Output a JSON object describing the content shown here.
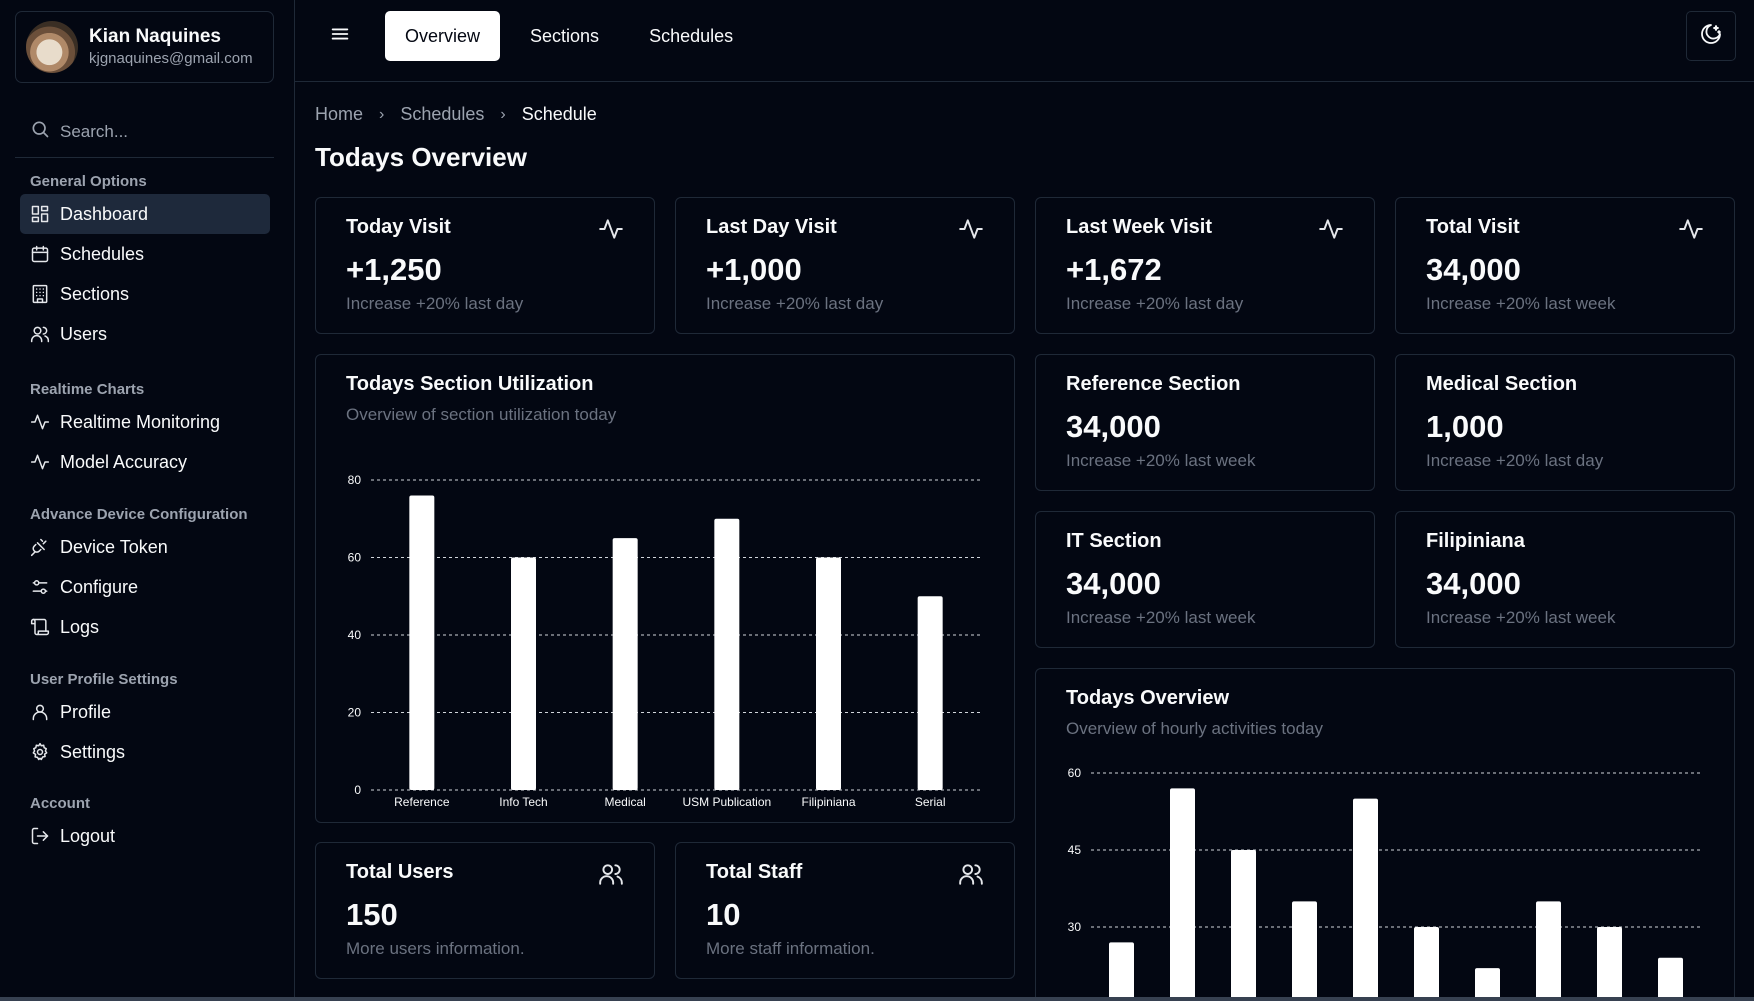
{
  "user": {
    "name": "Kian Naquines",
    "email": "kjgnaquines@gmail.com"
  },
  "search": {
    "placeholder": "Search..."
  },
  "sidebar": {
    "groups": [
      {
        "title": "General Options",
        "items": [
          {
            "label": "Dashboard",
            "icon": "dashboard-icon"
          },
          {
            "label": "Schedules",
            "icon": "calendar-icon"
          },
          {
            "label": "Sections",
            "icon": "building-icon"
          },
          {
            "label": "Users",
            "icon": "users-icon"
          }
        ]
      },
      {
        "title": "Realtime Charts",
        "items": [
          {
            "label": "Realtime Monitoring",
            "icon": "activity-icon"
          },
          {
            "label": "Model Accuracy",
            "icon": "activity-icon"
          }
        ]
      },
      {
        "title": "Advance Device Configuration",
        "items": [
          {
            "label": "Device Token",
            "icon": "plug-icon"
          },
          {
            "label": "Configure",
            "icon": "sliders-icon"
          },
          {
            "label": "Logs",
            "icon": "scroll-icon"
          }
        ]
      },
      {
        "title": "User Profile Settings",
        "items": [
          {
            "label": "Profile",
            "icon": "user-icon"
          },
          {
            "label": "Settings",
            "icon": "gear-icon"
          }
        ]
      },
      {
        "title": "Account",
        "items": [
          {
            "label": "Logout",
            "icon": "logout-icon"
          }
        ]
      }
    ]
  },
  "topbar": {
    "tabs": [
      "Overview",
      "Sections",
      "Schedules"
    ],
    "active_tab": "Overview"
  },
  "breadcrumb": [
    "Home",
    "Schedules",
    "Schedule"
  ],
  "page_title": "Todays Overview",
  "stats": [
    {
      "title": "Today Visit",
      "value": "+1,250",
      "sub": "Increase +20% last day"
    },
    {
      "title": "Last Day Visit",
      "value": "+1,000",
      "sub": "Increase +20% last day"
    },
    {
      "title": "Last Week Visit",
      "value": "+1,672",
      "sub": "Increase +20% last day"
    },
    {
      "title": "Total Visit",
      "value": "34,000",
      "sub": "Increase +20% last week"
    }
  ],
  "sections": [
    {
      "title": "Reference Section",
      "value": "34,000",
      "sub": "Increase +20% last week"
    },
    {
      "title": "Medical Section",
      "value": "1,000",
      "sub": "Increase +20% last day"
    },
    {
      "title": "IT Section",
      "value": "34,000",
      "sub": "Increase +20% last week"
    },
    {
      "title": "Filipiniana",
      "value": "34,000",
      "sub": "Increase +20% last week"
    }
  ],
  "totals": [
    {
      "title": "Total Users",
      "value": "150",
      "sub": "More users information."
    },
    {
      "title": "Total Staff",
      "value": "10",
      "sub": "More staff information."
    }
  ],
  "utilization_card": {
    "title": "Todays Section Utilization",
    "subtitle": "Overview of section utilization today"
  },
  "hourly_card": {
    "title": "Todays Overview",
    "subtitle": "Overview of hourly activities today"
  },
  "colors": {
    "background": "#030712",
    "border": "#1f2937",
    "bar": "#ffffff",
    "muted": "#6b7280"
  },
  "chart_data": [
    {
      "type": "bar",
      "title": "Todays Section Utilization",
      "categories": [
        "Reference",
        "Info Tech",
        "Medical",
        "USM Publication",
        "Filipiniana",
        "Serial"
      ],
      "values": [
        76,
        60,
        65,
        70,
        60,
        50
      ],
      "ylim": [
        0,
        80
      ],
      "yticks": [
        0,
        20,
        40,
        60,
        80
      ],
      "grid": true
    },
    {
      "type": "bar",
      "title": "Todays Overview",
      "values": [
        27,
        57,
        45,
        35,
        55,
        30,
        22,
        35,
        30,
        24
      ],
      "visible_yticks": [
        30,
        45,
        60
      ],
      "ylim": [
        0,
        60
      ],
      "grid": true
    }
  ]
}
